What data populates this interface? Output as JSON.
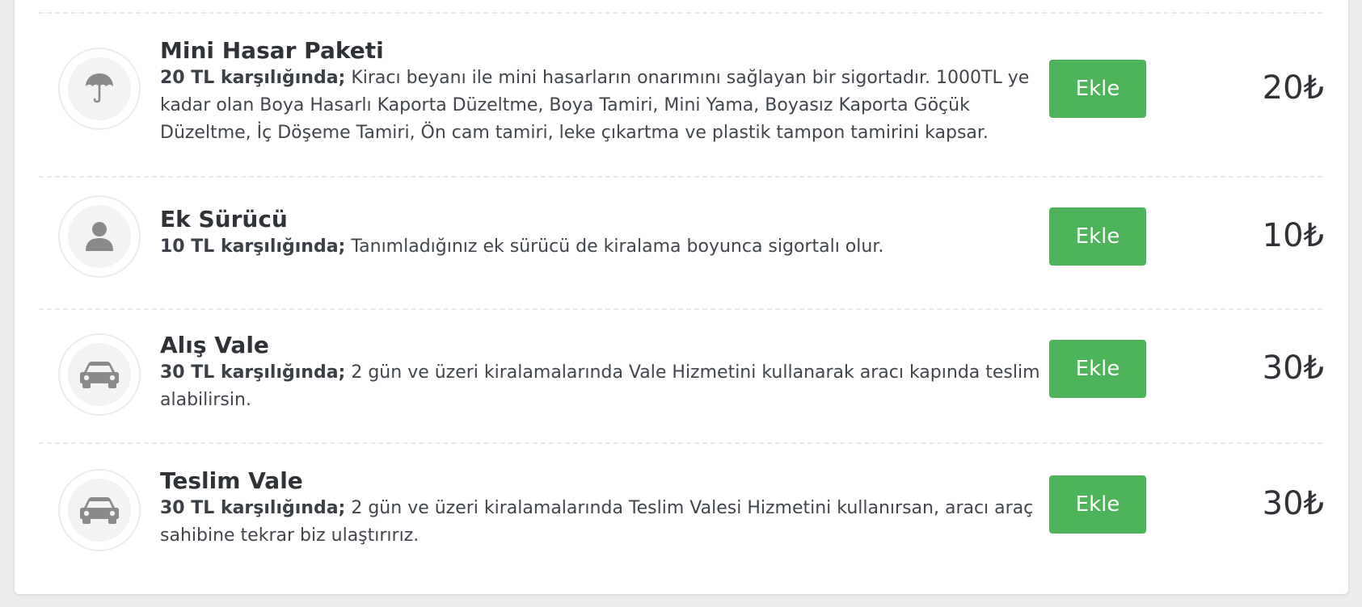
{
  "colors": {
    "accent_button": "#4db45a",
    "icon_gray": "#8a8a8a"
  },
  "extras": [
    {
      "icon": "umbrella-icon",
      "title": "Mini Hasar Paketi",
      "price_prefix": "20 TL karşılığında;",
      "description": " Kiracı beyanı ile mini hasarların onarımını sağlayan bir sigortadır. 1000TL ye kadar olan Boya Hasarlı Kaporta Düzeltme, Boya Tamiri, Mini Yama, Boyasız Kaporta Göçük Düzeltme, İç Döşeme Tamiri, Ön cam tamiri, leke çıkartma ve plastik tampon tamirini kapsar.",
      "button_label": "Ekle",
      "price": "20₺"
    },
    {
      "icon": "user-icon",
      "title": "Ek Sürücü",
      "price_prefix": "10 TL karşılığında;",
      "description": " Tanımladığınız ek sürücü de kiralama boyunca sigortalı olur.",
      "button_label": "Ekle",
      "price": "10₺"
    },
    {
      "icon": "car-icon",
      "title": "Alış Vale",
      "price_prefix": "30 TL karşılığında;",
      "description": " 2 gün ve üzeri kiralamalarında Vale Hizmetini kullanarak aracı kapında teslim alabilirsin.",
      "button_label": "Ekle",
      "price": "30₺"
    },
    {
      "icon": "car-icon",
      "title": "Teslim Vale",
      "price_prefix": "30 TL karşılığında;",
      "description": " 2 gün ve üzeri kiralamalarında Teslim Valesi Hizmetini kullanırsan, aracı araç sahibine tekrar biz ulaştırırız.",
      "button_label": "Ekle",
      "price": "30₺"
    }
  ]
}
